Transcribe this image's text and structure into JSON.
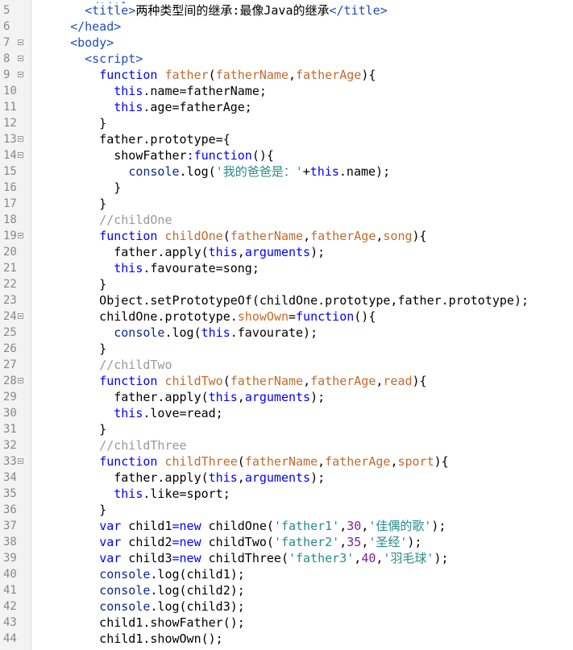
{
  "editor": {
    "lines": [
      {
        "num": "5",
        "fold": false,
        "tokens": [
          [
            "    ",
            ""
          ],
          [
            "<title>",
            "tag"
          ],
          [
            "两种类型间的继承:最像Java的继承",
            ""
          ],
          [
            "</title>",
            "tag"
          ]
        ]
      },
      {
        "num": "6",
        "fold": false,
        "tokens": [
          [
            "  ",
            ""
          ],
          [
            "</head>",
            "tag"
          ]
        ]
      },
      {
        "num": "7",
        "fold": true,
        "tokens": [
          [
            "  ",
            ""
          ],
          [
            "<body>",
            "tag"
          ]
        ]
      },
      {
        "num": "8",
        "fold": true,
        "tokens": [
          [
            "    ",
            ""
          ],
          [
            "<script>",
            "tag"
          ]
        ]
      },
      {
        "num": "9",
        "fold": true,
        "tokens": [
          [
            "      ",
            ""
          ],
          [
            "function",
            "kw"
          ],
          [
            " ",
            ""
          ],
          [
            "father",
            "fn"
          ],
          [
            "(",
            ""
          ],
          [
            "fatherName",
            "fn"
          ],
          [
            ",",
            ""
          ],
          [
            "fatherAge",
            "fn"
          ],
          [
            "){",
            ""
          ]
        ]
      },
      {
        "num": "10",
        "fold": false,
        "tokens": [
          [
            "        ",
            ""
          ],
          [
            "this",
            "kw"
          ],
          [
            ".name=fatherName;",
            ""
          ]
        ]
      },
      {
        "num": "11",
        "fold": false,
        "tokens": [
          [
            "        ",
            ""
          ],
          [
            "this",
            "kw"
          ],
          [
            ".age=fatherAge;",
            ""
          ]
        ]
      },
      {
        "num": "12",
        "fold": false,
        "tokens": [
          [
            "      }",
            ""
          ]
        ]
      },
      {
        "num": "13",
        "fold": true,
        "tokens": [
          [
            "      father.prototype={",
            ""
          ]
        ]
      },
      {
        "num": "14",
        "fold": true,
        "tokens": [
          [
            "        showFather",
            ""
          ],
          [
            ":",
            "kw"
          ],
          [
            "function",
            "kw"
          ],
          [
            "(){",
            ""
          ]
        ]
      },
      {
        "num": "15",
        "fold": false,
        "tokens": [
          [
            "          ",
            ""
          ],
          [
            "console",
            "navy"
          ],
          [
            ".log(",
            ""
          ],
          [
            "'我的爸爸是：'",
            "str"
          ],
          [
            "+",
            ""
          ],
          [
            "this",
            "kw"
          ],
          [
            ".name);",
            ""
          ]
        ]
      },
      {
        "num": "16",
        "fold": false,
        "tokens": [
          [
            "        }",
            ""
          ]
        ]
      },
      {
        "num": "17",
        "fold": false,
        "tokens": [
          [
            "      }",
            ""
          ]
        ]
      },
      {
        "num": "18",
        "fold": false,
        "tokens": [
          [
            "      ",
            ""
          ],
          [
            "//childOne",
            "com"
          ]
        ]
      },
      {
        "num": "19",
        "fold": true,
        "tokens": [
          [
            "      ",
            ""
          ],
          [
            "function",
            "kw"
          ],
          [
            " ",
            ""
          ],
          [
            "childOne",
            "fn"
          ],
          [
            "(",
            ""
          ],
          [
            "fatherName",
            "fn"
          ],
          [
            ",",
            ""
          ],
          [
            "fatherAge",
            "fn"
          ],
          [
            ",",
            ""
          ],
          [
            "song",
            "fn"
          ],
          [
            "){",
            ""
          ]
        ]
      },
      {
        "num": "20",
        "fold": false,
        "tokens": [
          [
            "        father.apply(",
            ""
          ],
          [
            "this",
            "kw"
          ],
          [
            ",",
            ""
          ],
          [
            "arguments",
            "kw"
          ],
          [
            ");",
            ""
          ]
        ]
      },
      {
        "num": "21",
        "fold": false,
        "tokens": [
          [
            "        ",
            ""
          ],
          [
            "this",
            "kw"
          ],
          [
            ".favourate=song;",
            ""
          ]
        ]
      },
      {
        "num": "22",
        "fold": false,
        "tokens": [
          [
            "      }",
            ""
          ]
        ]
      },
      {
        "num": "23",
        "fold": false,
        "tokens": [
          [
            "      Object.setPrototypeOf(childOne.prototype,father.prototype);",
            ""
          ]
        ]
      },
      {
        "num": "24",
        "fold": true,
        "tokens": [
          [
            "      childOne.prototype.",
            ""
          ],
          [
            "showOwn",
            "fn"
          ],
          [
            "=",
            ""
          ],
          [
            "function",
            "kw"
          ],
          [
            "(){",
            ""
          ]
        ]
      },
      {
        "num": "25",
        "fold": false,
        "tokens": [
          [
            "        ",
            ""
          ],
          [
            "console",
            "navy"
          ],
          [
            ".log(",
            ""
          ],
          [
            "this",
            "kw"
          ],
          [
            ".favourate);",
            ""
          ]
        ]
      },
      {
        "num": "26",
        "fold": false,
        "tokens": [
          [
            "      }",
            ""
          ]
        ]
      },
      {
        "num": "27",
        "fold": false,
        "tokens": [
          [
            "      ",
            ""
          ],
          [
            "//childTwo",
            "com"
          ]
        ]
      },
      {
        "num": "28",
        "fold": true,
        "tokens": [
          [
            "      ",
            ""
          ],
          [
            "function",
            "kw"
          ],
          [
            " ",
            ""
          ],
          [
            "childTwo",
            "fn"
          ],
          [
            "(",
            ""
          ],
          [
            "fatherName",
            "fn"
          ],
          [
            ",",
            ""
          ],
          [
            "fatherAge",
            "fn"
          ],
          [
            ",",
            ""
          ],
          [
            "read",
            "fn"
          ],
          [
            "){",
            ""
          ]
        ]
      },
      {
        "num": "29",
        "fold": false,
        "tokens": [
          [
            "        father.apply(",
            ""
          ],
          [
            "this",
            "kw"
          ],
          [
            ",",
            ""
          ],
          [
            "arguments",
            "kw"
          ],
          [
            ");",
            ""
          ]
        ]
      },
      {
        "num": "30",
        "fold": false,
        "tokens": [
          [
            "        ",
            ""
          ],
          [
            "this",
            "kw"
          ],
          [
            ".love=read;",
            ""
          ]
        ]
      },
      {
        "num": "31",
        "fold": false,
        "tokens": [
          [
            "      }",
            ""
          ]
        ]
      },
      {
        "num": "32",
        "fold": false,
        "tokens": [
          [
            "      ",
            ""
          ],
          [
            "//childThree",
            "com"
          ]
        ]
      },
      {
        "num": "33",
        "fold": true,
        "tokens": [
          [
            "      ",
            ""
          ],
          [
            "function",
            "kw"
          ],
          [
            " ",
            ""
          ],
          [
            "childThree",
            "fn"
          ],
          [
            "(",
            ""
          ],
          [
            "fatherName",
            "fn"
          ],
          [
            ",",
            ""
          ],
          [
            "fatherAge",
            "fn"
          ],
          [
            ",",
            ""
          ],
          [
            "sport",
            "fn"
          ],
          [
            "){",
            ""
          ]
        ]
      },
      {
        "num": "34",
        "fold": false,
        "tokens": [
          [
            "        father.apply(",
            ""
          ],
          [
            "this",
            "kw"
          ],
          [
            ",",
            ""
          ],
          [
            "arguments",
            "kw"
          ],
          [
            ");",
            ""
          ]
        ]
      },
      {
        "num": "35",
        "fold": false,
        "tokens": [
          [
            "        ",
            ""
          ],
          [
            "this",
            "kw"
          ],
          [
            ".like=sport;",
            ""
          ]
        ]
      },
      {
        "num": "36",
        "fold": false,
        "tokens": [
          [
            "      }",
            ""
          ]
        ]
      },
      {
        "num": "37",
        "fold": false,
        "tokens": [
          [
            "      ",
            ""
          ],
          [
            "var",
            "kw"
          ],
          [
            " child1",
            ""
          ],
          [
            "=new",
            "kw"
          ],
          [
            " childOne(",
            ""
          ],
          [
            "'father1'",
            "str"
          ],
          [
            ",",
            ""
          ],
          [
            "30",
            "num"
          ],
          [
            ",",
            ""
          ],
          [
            "'佳偶的歌'",
            "str"
          ],
          [
            ");",
            ""
          ]
        ]
      },
      {
        "num": "38",
        "fold": false,
        "tokens": [
          [
            "      ",
            ""
          ],
          [
            "var",
            "kw"
          ],
          [
            " child2",
            ""
          ],
          [
            "=new",
            "kw"
          ],
          [
            " childTwo(",
            ""
          ],
          [
            "'father2'",
            "str"
          ],
          [
            ",",
            ""
          ],
          [
            "35",
            "num"
          ],
          [
            ",",
            ""
          ],
          [
            "'圣经'",
            "str"
          ],
          [
            ");",
            ""
          ]
        ]
      },
      {
        "num": "39",
        "fold": false,
        "tokens": [
          [
            "      ",
            ""
          ],
          [
            "var",
            "kw"
          ],
          [
            " child3",
            ""
          ],
          [
            "=new",
            "kw"
          ],
          [
            " childThree(",
            ""
          ],
          [
            "'father3'",
            "str"
          ],
          [
            ",",
            ""
          ],
          [
            "40",
            "num"
          ],
          [
            ",",
            ""
          ],
          [
            "'羽毛球'",
            "str"
          ],
          [
            ");",
            ""
          ]
        ]
      },
      {
        "num": "40",
        "fold": false,
        "tokens": [
          [
            "      ",
            ""
          ],
          [
            "console",
            "navy"
          ],
          [
            ".log(child1);",
            ""
          ]
        ]
      },
      {
        "num": "41",
        "fold": false,
        "tokens": [
          [
            "      ",
            ""
          ],
          [
            "console",
            "navy"
          ],
          [
            ".log(child2);",
            ""
          ]
        ]
      },
      {
        "num": "42",
        "fold": false,
        "tokens": [
          [
            "      ",
            ""
          ],
          [
            "console",
            "navy"
          ],
          [
            ".log(child3);",
            ""
          ]
        ]
      },
      {
        "num": "43",
        "fold": false,
        "tokens": [
          [
            "      child1.showFather();",
            ""
          ]
        ]
      },
      {
        "num": "44",
        "fold": false,
        "tokens": [
          [
            "      child1.showOwn();",
            ""
          ]
        ]
      }
    ]
  },
  "colors": {
    "kw": "#0000ff",
    "fn": "#c36a2d",
    "str": "#2a8a8a",
    "num": "#7a1fa2",
    "com": "#999999",
    "tag": "#1f4fb8",
    "navy": "#0b2a8a"
  }
}
